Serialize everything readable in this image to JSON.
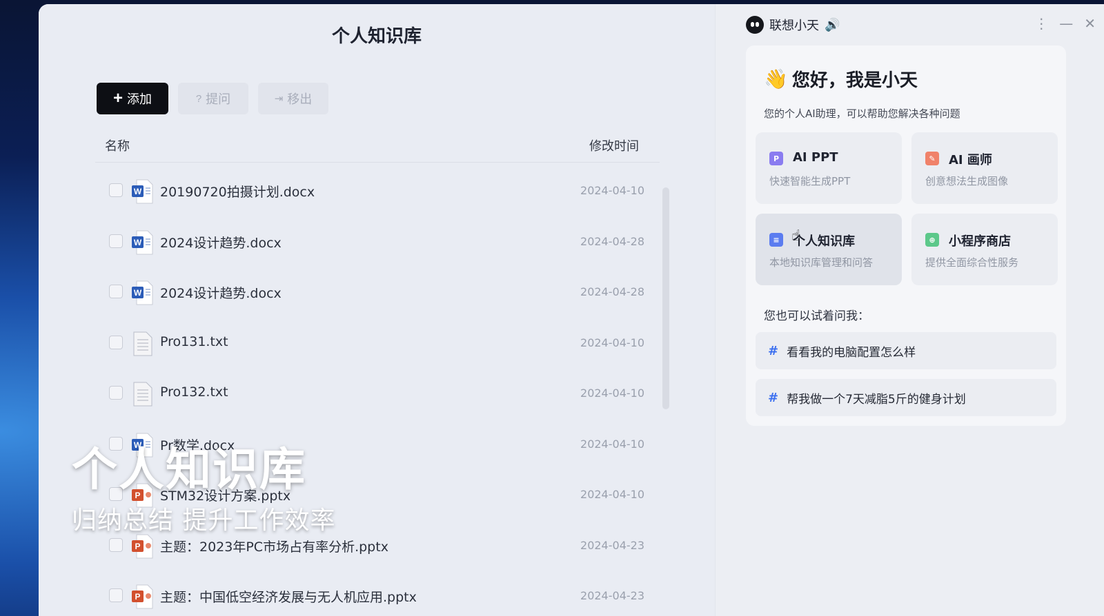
{
  "knowledge_base": {
    "title": "个人知识库",
    "toolbar": {
      "add_label": "添加",
      "ask_label": "提问",
      "remove_label": "移出"
    },
    "columns": {
      "name": "名称",
      "modified": "修改时间"
    },
    "files": [
      {
        "name": "20190720拍摄计划.docx",
        "date": "2024-04-10",
        "type": "word-icon"
      },
      {
        "name": "2024设计趋势.docx",
        "date": "2024-04-28",
        "type": "word-icon"
      },
      {
        "name": "2024设计趋势.docx",
        "date": "2024-04-28",
        "type": "word-icon"
      },
      {
        "name": "Pro131.txt",
        "date": "2024-04-10",
        "type": "text-file-icon"
      },
      {
        "name": "Pro132.txt",
        "date": "2024-04-10",
        "type": "text-file-icon"
      },
      {
        "name": "Pr数学.docx",
        "date": "2024-04-10",
        "type": "word-icon"
      },
      {
        "name": "STM32设计方案.pptx",
        "date": "2024-04-10",
        "type": "powerpoint-icon"
      },
      {
        "name": "主题：2023年PC市场占有率分析.pptx",
        "date": "2024-04-23",
        "type": "powerpoint-icon"
      },
      {
        "name": "主题：中国低空经济发展与无人机应用.pptx",
        "date": "2024-04-23",
        "type": "powerpoint-icon"
      }
    ]
  },
  "caption": {
    "title": "个人知识库",
    "subtitle": "归纳总结 提升工作效率"
  },
  "assistant": {
    "name": "联想小天",
    "greeting": "您好，我是小天",
    "intro": "您的个人AI助理，可以帮助您解决各种问题",
    "features": [
      {
        "title": "AI PPT",
        "desc": "快速智能生成PPT",
        "icon": "ppt-icon",
        "color": "#8a7cf0"
      },
      {
        "title": "AI 画师",
        "desc": "创意想法生成图像",
        "icon": "painter-icon",
        "color": "#f0826a"
      },
      {
        "title": "个人知识库",
        "desc": "本地知识库管理和问答",
        "icon": "knowledge-icon",
        "color": "#5b7cf0"
      },
      {
        "title": "小程序商店",
        "desc": "提供全面综合性服务",
        "icon": "store-icon",
        "color": "#5cc88a"
      }
    ],
    "try_label": "您也可以试着问我：",
    "prompts": [
      "看看我的电脑配置怎么样",
      "帮我做一个7天减脂5斤的健身计划"
    ]
  },
  "colors": {
    "accent": "#3b6ff0",
    "word": "#2b5cb8",
    "ppt": "#d2502e"
  }
}
